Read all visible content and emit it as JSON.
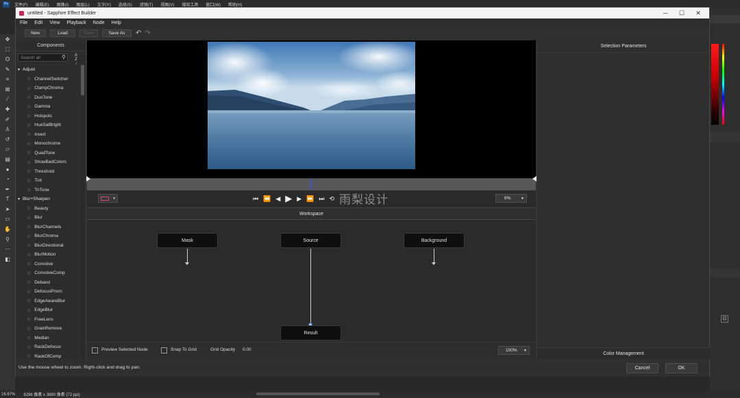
{
  "ps": {
    "logo": "Ps",
    "menus": [
      "文件(F)",
      "编辑(E)",
      "图像(I)",
      "图层(L)",
      "文字(Y)",
      "选择(S)",
      "滤镜(T)",
      "视图(V)",
      "增效工具",
      "窗口(W)",
      "帮助(H)"
    ],
    "status_zoom": "16.67%",
    "status_info": "6296 像素 x 3880 像素 (72 ppi)"
  },
  "window": {
    "title": "untitled - Sapphire Effect Builder",
    "minimize": "─",
    "maximize": "☐",
    "close": "✕"
  },
  "menu": [
    "File",
    "Edit",
    "View",
    "Playback",
    "Node",
    "Help"
  ],
  "toolbar": {
    "new_label": "New",
    "load_label": "Load",
    "save_label": "Save",
    "saveas_label": "Save As"
  },
  "components": {
    "header": "Components",
    "search_placeholder": "Search all",
    "groups": [
      {
        "name": "Adjust",
        "items": [
          "ChannelSwitcher",
          "ClampChroma",
          "DuoTone",
          "Gamma",
          "Hotspots",
          "HueSatBright",
          "Invert",
          "Monochrome",
          "QuadTone",
          "ShowBadColors",
          "Threshold",
          "Tint",
          "TriTone"
        ]
      },
      {
        "name": "Blur+Sharpen",
        "items": [
          "Beauty",
          "Blur",
          "BlurChannels",
          "BlurChroma",
          "BlurDirectional",
          "BlurMotion",
          "Convolve",
          "ConvolveComp",
          "Deband",
          "DefocusPrism",
          "EdgeAwareBlur",
          "EdgeBlur",
          "FreeLens",
          "GrainRemove",
          "Median",
          "RackDefocus",
          "RackOfComp"
        ]
      }
    ]
  },
  "viewer": {
    "zoom": "8%"
  },
  "workspace": {
    "header": "Workspace",
    "nodes": {
      "mask": "Mask",
      "source": "Source",
      "background": "Background",
      "result": "Result"
    },
    "preview_selected_label": "Preview Selected Node",
    "snap_to_grid_label": "Snap To Grid",
    "grid_opacity_label": "Grid Opacity",
    "grid_opacity_value": "0.00",
    "zoom": "100%"
  },
  "selection_params": {
    "header": "Selection Parameters",
    "color_management": "Color Management"
  },
  "hint": "Use the mouse wheel to zoom.  Right-click and drag to pan.",
  "dialog": {
    "cancel_label": "Cancel",
    "ok_label": "OK"
  },
  "watermark": "雨梨设计",
  "colors": {
    "accent_playhead": "#3a52d6",
    "app_icon": "#c9245d"
  }
}
